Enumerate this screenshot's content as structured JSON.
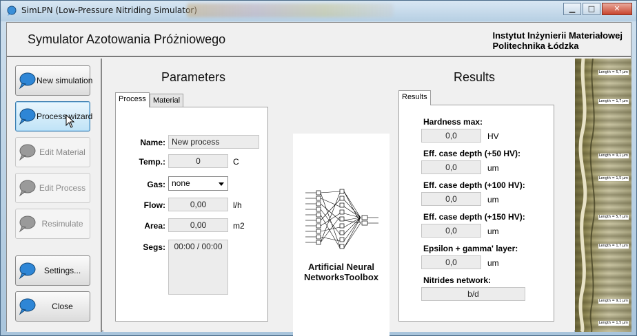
{
  "window": {
    "title": "SimLPN (Low-Pressure Nitriding Simulator)",
    "minimize": "▁",
    "maximize": "□",
    "close": "✕"
  },
  "header": {
    "app_title": "Symulator Azotowania Próżniowego",
    "institute_line1": "Instytut Inżynierii Materiałowej",
    "institute_line2": "Politechnika Łódzka"
  },
  "sidebar": {
    "new_simulation": "New simulation",
    "process_wizard": "Process wizard",
    "edit_material": "Edit Material",
    "edit_process": "Edit Process",
    "resimulate": "Resimulate",
    "settings": "Settings...",
    "close": "Close"
  },
  "parameters": {
    "title": "Parameters",
    "tabs": [
      "Process",
      "Material"
    ],
    "name_label": "Name:",
    "name_value": "New process",
    "temp_label": "Temp.:",
    "temp_value": "0",
    "temp_unit": "C",
    "gas_label": "Gas:",
    "gas_value": "none",
    "flow_label": "Flow:",
    "flow_value": "0,00",
    "flow_unit": "l/h",
    "area_label": "Area:",
    "area_value": "0,00",
    "area_unit": "m2",
    "segs_label": "Segs:",
    "segs_value": "00:00 / 00:00"
  },
  "ann": {
    "line1": "Artificial Neural",
    "line2": "NetworksToolbox"
  },
  "results": {
    "title": "Results",
    "tab": "Results",
    "hardness_label": "Hardness max:",
    "hardness_value": "0,0",
    "hardness_unit": "HV",
    "eff50_label": "Eff. case depth (+50 HV):",
    "eff50_value": "0,0",
    "eff50_unit": "um",
    "eff100_label": "Eff. case depth (+100 HV):",
    "eff100_value": "0,0",
    "eff100_unit": "um",
    "eff150_label": "Eff. case depth (+150 HV):",
    "eff150_value": "0,0",
    "eff150_unit": "um",
    "epsilon_label": "Epsilon + gamma' layer:",
    "epsilon_value": "0,0",
    "epsilon_unit": "um",
    "nitrides_label": "Nitrides network:",
    "nitrides_value": "b/d"
  },
  "micrograph": {
    "labels": [
      "Length = 5,7 µm",
      "Length = 1,7 µm",
      "Length = 9,1 µm",
      "Length = 1,5 µm",
      "Length = 5,7 µm",
      "Length = 1,7 µm",
      "Length = 9,1 µm",
      "Length = 1,5 µm"
    ]
  }
}
